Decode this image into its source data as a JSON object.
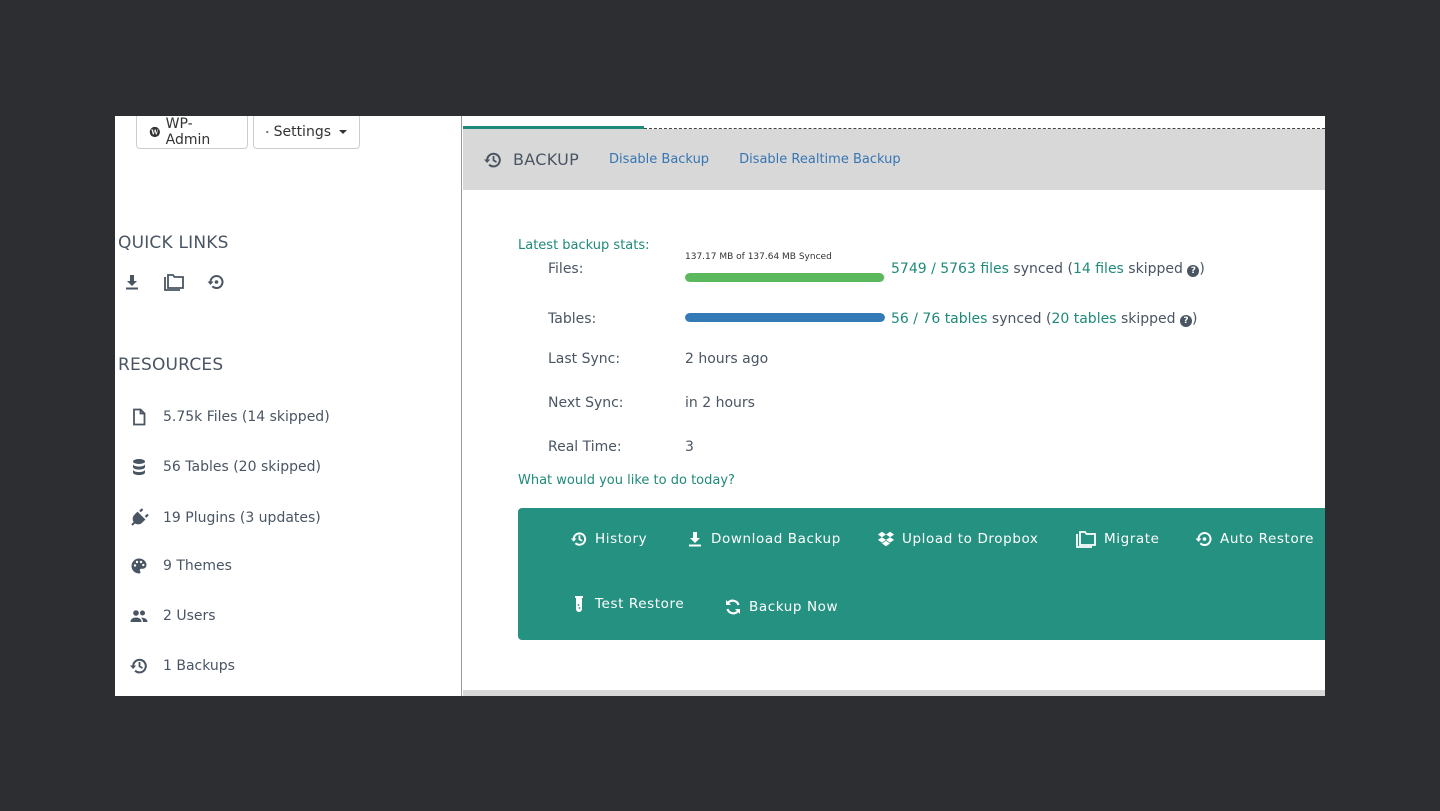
{
  "sidebar": {
    "buttons": {
      "wp_admin": "WP-Admin",
      "settings": "Settings"
    },
    "quick_links_title": "QUICK LINKS",
    "quick_links": [
      {
        "icon": "download-icon",
        "label": "Download"
      },
      {
        "icon": "folders-icon",
        "label": "Migrate"
      },
      {
        "icon": "restore-icon",
        "label": "Restore"
      }
    ],
    "resources_title": "RESOURCES",
    "resources": [
      {
        "icon": "file-icon",
        "label": "5.75k Files (14 skipped)"
      },
      {
        "icon": "database-icon",
        "label": "56 Tables (20 skipped)"
      },
      {
        "icon": "plugin-icon",
        "label": "19 Plugins (3 updates)"
      },
      {
        "icon": "palette-icon",
        "label": "9 Themes"
      },
      {
        "icon": "users-icon",
        "label": "2 Users"
      },
      {
        "icon": "history-icon",
        "label": "1 Backups"
      }
    ]
  },
  "header": {
    "title": "BACKUP",
    "links": [
      "Disable Backup",
      "Disable Realtime Backup"
    ],
    "tab_progress": 0.21
  },
  "stats": {
    "label": "Latest backup stats:",
    "files": {
      "label": "Files:",
      "caption": "137.17 MB of 137.64 MB Synced",
      "progress": 0.997,
      "color": "#5cb85c",
      "synced": "5749 / 5763 files",
      "synced_suffix": " synced (",
      "skipped": "14 files",
      "skipped_suffix": " skipped ",
      "close": ")"
    },
    "tables": {
      "label": "Tables:",
      "progress": 1.0,
      "color": "#337ab7",
      "synced": "56 / 76 tables",
      "synced_suffix": " synced (",
      "skipped": "20 tables",
      "skipped_suffix": " skipped ",
      "close": ")"
    },
    "last_sync": {
      "label": "Last Sync:",
      "value": "2 hours ago"
    },
    "next_sync": {
      "label": "Next Sync:",
      "value": "in 2 hours"
    },
    "real_time": {
      "label": "Real Time:",
      "value": "3"
    }
  },
  "question": "What would you like to do today?",
  "actions": [
    {
      "icon": "history-icon",
      "label": "History"
    },
    {
      "icon": "download-icon",
      "label": "Download Backup"
    },
    {
      "icon": "dropbox-icon",
      "label": "Upload to Dropbox"
    },
    {
      "icon": "folders-icon",
      "label": "Migrate"
    },
    {
      "icon": "restore-icon",
      "label": "Auto Restore"
    },
    {
      "icon": "test-tube-icon",
      "label": "Test Restore"
    },
    {
      "icon": "sync-icon",
      "label": "Backup Now"
    }
  ],
  "colors": {
    "accent": "#249181",
    "link": "#3776b3",
    "text": "#4a5563"
  }
}
